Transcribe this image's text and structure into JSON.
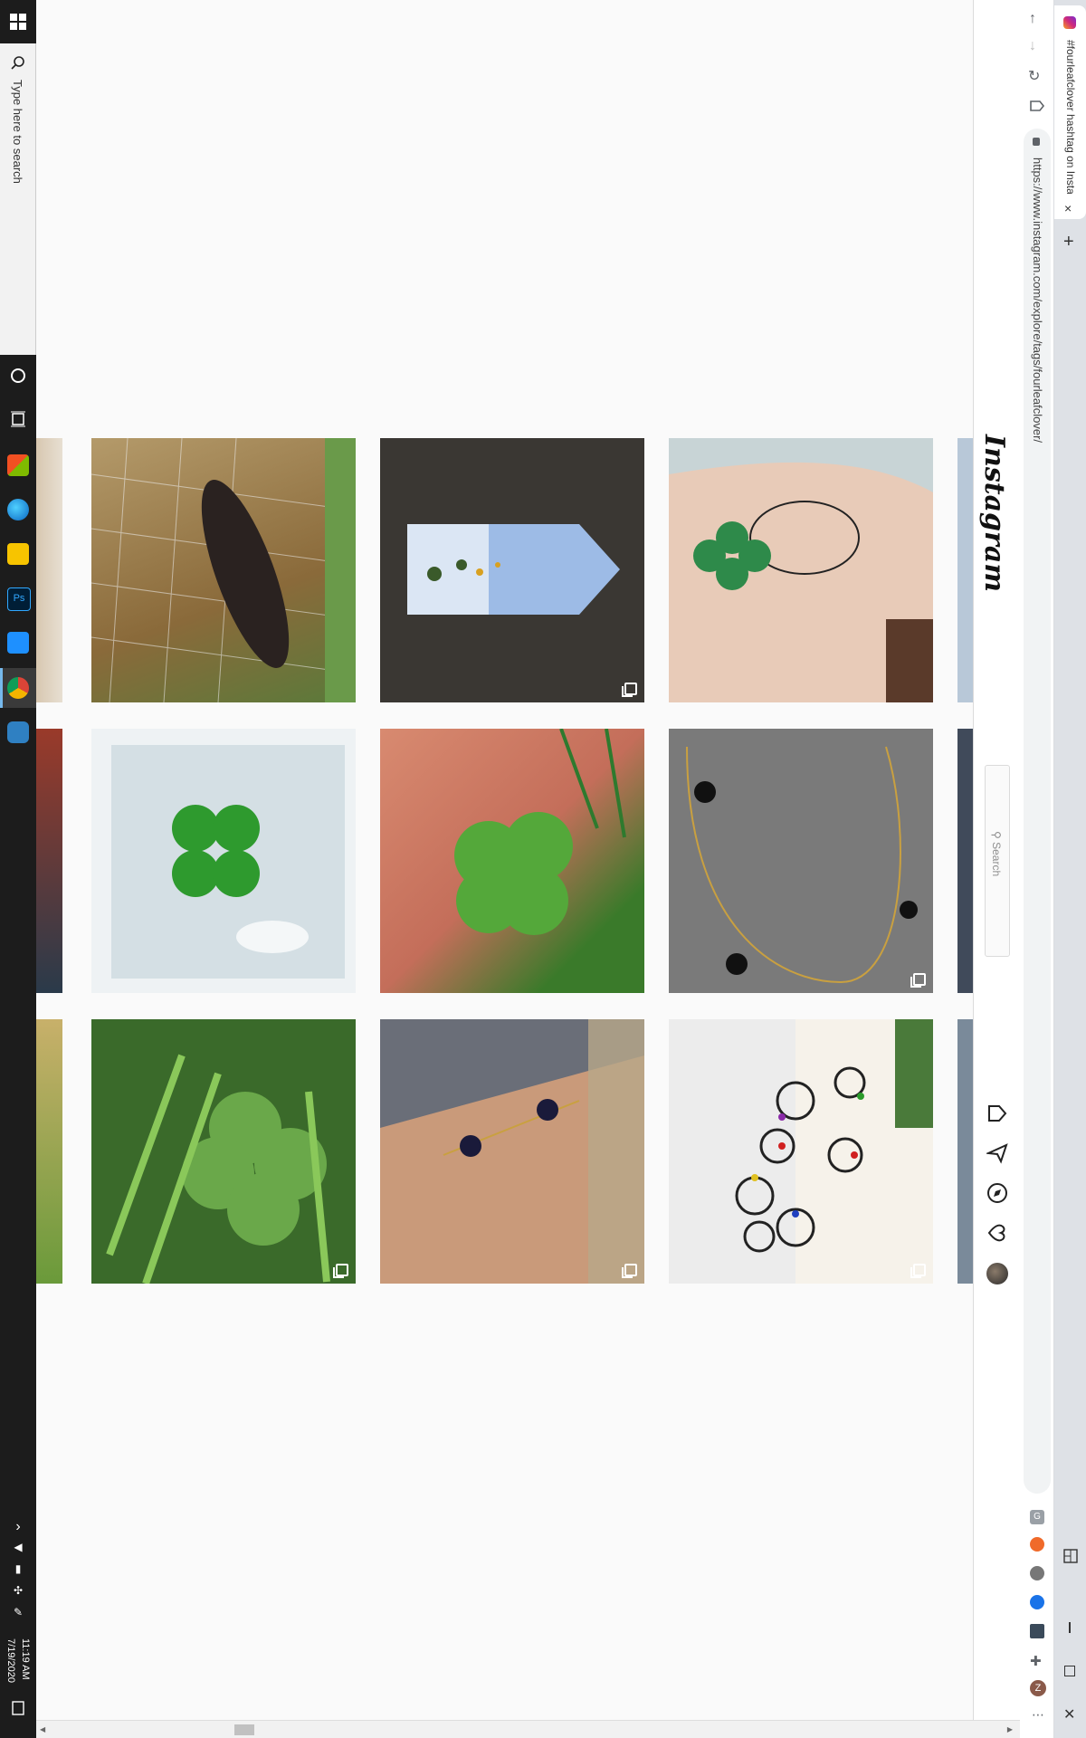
{
  "taskbar": {
    "search_placeholder": "Type here to search",
    "time": "11:19 AM",
    "date": "7/19/2020"
  },
  "browser": {
    "tab_title": "#fourleafclover hashtag on Insta",
    "url": "https://www.instagram.com/explore/tags/fourleafclover/",
    "new_tab_label": "+",
    "close_tab_label": "×"
  },
  "instagram": {
    "logo": "Instagram",
    "search_placeholder": "Search"
  },
  "grid": {
    "rows": [
      [
        {
          "subject": "cat climbing wire fence",
          "multi": false
        },
        {
          "subject": "painted flower bookmark",
          "multi": true
        },
        {
          "subject": "bear and clover tattoo",
          "multi": false
        }
      ],
      [
        {
          "subject": "four leaf clover in water dish",
          "multi": false
        },
        {
          "subject": "four leaf clover in palm",
          "multi": false
        },
        {
          "subject": "gold clover necklace",
          "multi": true
        }
      ],
      [
        {
          "subject": "clover patch in grass",
          "multi": true
        },
        {
          "subject": "gold clover bracelet on wrist",
          "multi": true
        },
        {
          "subject": "clover rings display",
          "multi": true
        }
      ]
    ]
  },
  "colors": {
    "taskbar_bg": "#1c1c1c",
    "page_bg": "#fafafa",
    "clover_green": "#3a9a2e"
  }
}
